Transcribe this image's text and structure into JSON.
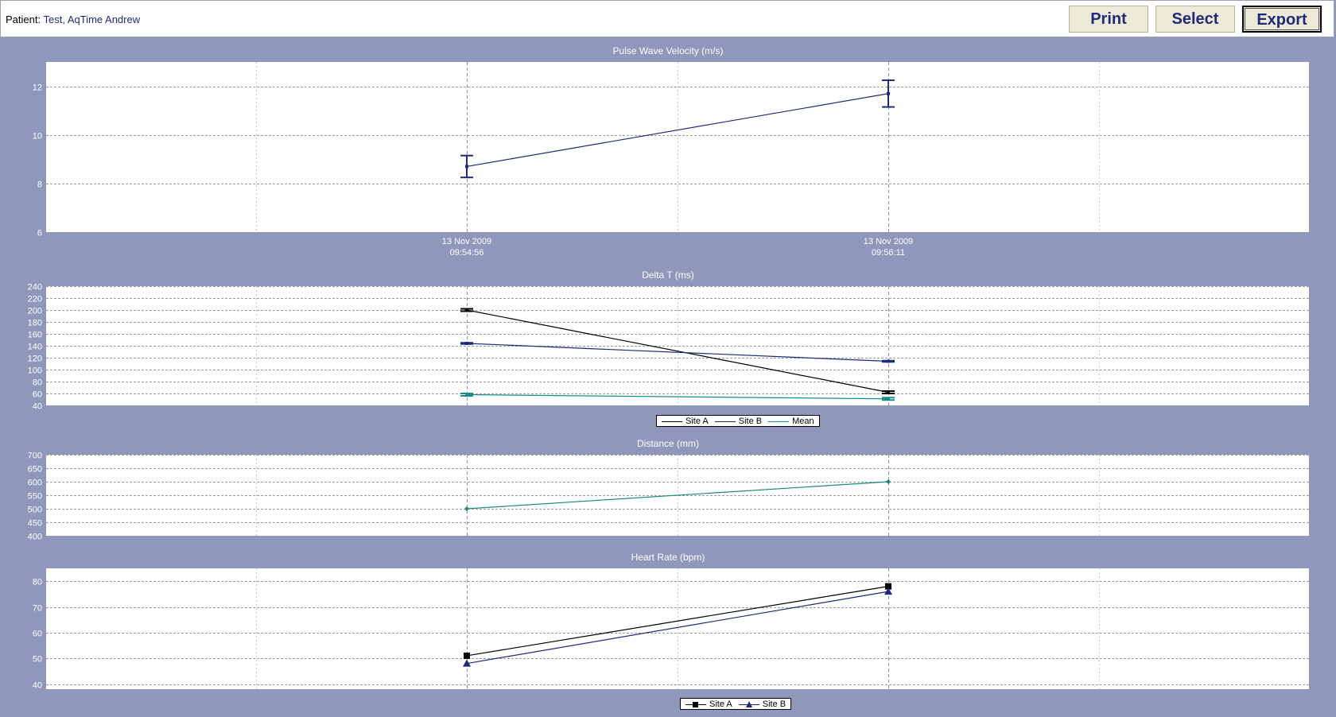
{
  "header": {
    "patient_label": "Patient:",
    "patient_name": "Test, AqTime Andrew",
    "buttons": {
      "print": "Print",
      "select": "Select",
      "export": "Export"
    }
  },
  "colors": {
    "background": "#8f97bb",
    "site_a": "#000000",
    "site_b": "#1f2a7a",
    "mean": "#1a8a8a",
    "distance": "#1a8a7a"
  },
  "chart_data": [
    {
      "type": "line",
      "title": "Pulse Wave Velocity (m/s)",
      "x": [
        "13 Nov 2009 09:54:56",
        "13 Nov 2009 09:56:11"
      ],
      "x_ticks": [
        {
          "line1": "13 Nov 2009",
          "line2": "09:54:56"
        },
        {
          "line1": "13 Nov 2009",
          "line2": "09:56:11"
        }
      ],
      "ylim": [
        6,
        13
      ],
      "yticks": [
        6,
        8,
        10,
        12
      ],
      "grid": true,
      "series": [
        {
          "values": [
            8.7,
            11.7
          ],
          "errors": [
            [
              8.25,
              9.15
            ],
            [
              11.15,
              12.25
            ]
          ]
        }
      ]
    },
    {
      "type": "line",
      "title": "Delta T (ms)",
      "x": [
        "13 Nov 2009 09:54:56",
        "13 Nov 2009 09:56:11"
      ],
      "ylim": [
        40,
        240
      ],
      "yticks": [
        40,
        60,
        80,
        100,
        120,
        140,
        160,
        180,
        200,
        220,
        240
      ],
      "grid": true,
      "legend": "bottom",
      "series": [
        {
          "name": "Site A",
          "values": [
            200,
            62
          ],
          "errors": [
            [
              198,
              202
            ],
            [
              60,
              64
            ]
          ]
        },
        {
          "name": "Site B",
          "values": [
            144,
            114
          ],
          "errors": [
            [
              143,
              145
            ],
            [
              113,
              115
            ]
          ]
        },
        {
          "name": "Mean",
          "values": [
            58,
            51
          ],
          "errors": [
            [
              56,
              60
            ],
            [
              49,
              53
            ]
          ]
        }
      ]
    },
    {
      "type": "line",
      "title": "Distance (mm)",
      "x": [
        "13 Nov 2009 09:54:56",
        "13 Nov 2009 09:56:11"
      ],
      "ylim": [
        400,
        700
      ],
      "yticks": [
        400,
        450,
        500,
        550,
        600,
        650,
        700
      ],
      "grid": true,
      "series": [
        {
          "values": [
            500,
            600
          ]
        }
      ]
    },
    {
      "type": "line",
      "title": "Heart Rate (bpm)",
      "x": [
        "13 Nov 2009 09:54:56",
        "13 Nov 2009 09:56:11"
      ],
      "ylim": [
        38,
        85
      ],
      "yticks": [
        40,
        50,
        60,
        70,
        80
      ],
      "grid": true,
      "legend": "bottom",
      "series": [
        {
          "name": "Site A",
          "values": [
            51,
            78
          ]
        },
        {
          "name": "Site B",
          "values": [
            48,
            76
          ]
        }
      ]
    }
  ]
}
